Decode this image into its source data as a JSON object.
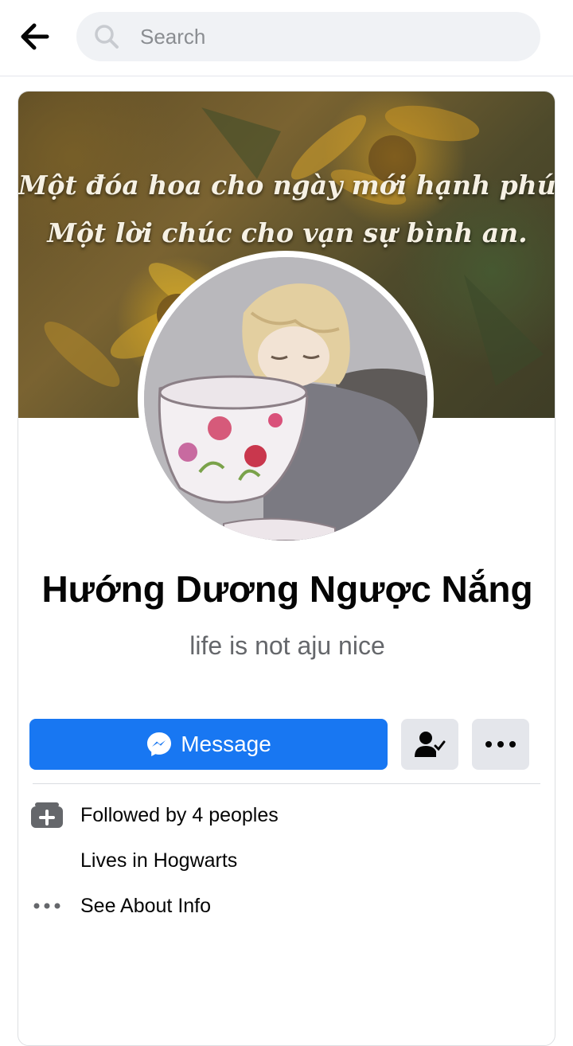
{
  "header": {
    "back_icon": "arrow-left-icon",
    "search": {
      "placeholder": "Search",
      "value": "",
      "icon": "search-icon"
    }
  },
  "profile": {
    "cover": {
      "line1": "Một đóa hoa cho ngày mới hạnh phúc",
      "line2": "Một lời chúc cho vạn sự bình an."
    },
    "name": "Hướng Dương Ngược Nắng",
    "bio": "life is not aju nice"
  },
  "actions": {
    "message_label": "Message",
    "message_icon": "messenger-icon",
    "friend_icon": "friend-check-icon",
    "more_icon": "more-dots-icon"
  },
  "info": {
    "followed": "Followed by 4 peoples",
    "lives": "Lives in Hogwarts",
    "about": "See About Info"
  },
  "colors": {
    "accent": "#1877f2",
    "secondary_button": "#e4e6eb",
    "muted_text": "#65676b"
  }
}
